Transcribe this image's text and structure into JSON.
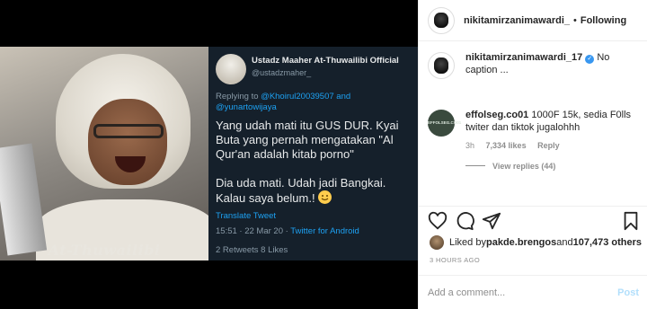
{
  "media": {
    "photo_caption": "At-Thuwailibi",
    "tweet": {
      "name": "Ustadz Maaher At-Thuwailibi Official",
      "handle": "@ustadzmaher_",
      "replying_prefix": "Replying to ",
      "replying_users": "@Khoirul20039507 and @yunartowijaya",
      "text": "Yang udah mati itu GUS DUR. Kyai Buta yang pernah mengatakan \"Al Qur'an adalah kitab porno\"\n\nDia uda mati. Udah jadi Bangkai. Kalau saya belum.!",
      "translate": "Translate Tweet",
      "timestamp": "15:51 · 22 Mar 20 · ",
      "source": "Twitter for Android",
      "stats": "2 Retweets   8 Likes"
    }
  },
  "post_header": {
    "username": "nikitamirzanimawardi_",
    "separator": "•",
    "follow_state": "Following"
  },
  "comments": [
    {
      "username": "nikitamirzanimawardi_17",
      "verified": true,
      "text": "No caption ..."
    },
    {
      "username": "effolseg.co01",
      "avatar_text": "EFFOLSEG.CO01",
      "text": "1000F 15k, sedia F0lls twiter dan tiktok jugalohhh",
      "age": "3h",
      "likes": "7,334 likes",
      "reply": "Reply",
      "view_replies": "View replies (44)"
    }
  ],
  "actions": {
    "icons": [
      "heart-icon",
      "comment-icon",
      "share-icon",
      "bookmark-icon"
    ]
  },
  "likes": {
    "prefix": "Liked by ",
    "user": "pakde.brengos",
    "middle": " and ",
    "count": "107,473 others"
  },
  "time_ago": "3 HOURS AGO",
  "add_comment": {
    "placeholder": "Add a comment...",
    "post_label": "Post"
  },
  "colors": {
    "tweet_bg": "#15202b",
    "link_blue": "#1da1f2",
    "ig_text": "#262626",
    "ig_muted": "#8e8e8e",
    "post_disabled": "#b2dffc"
  }
}
